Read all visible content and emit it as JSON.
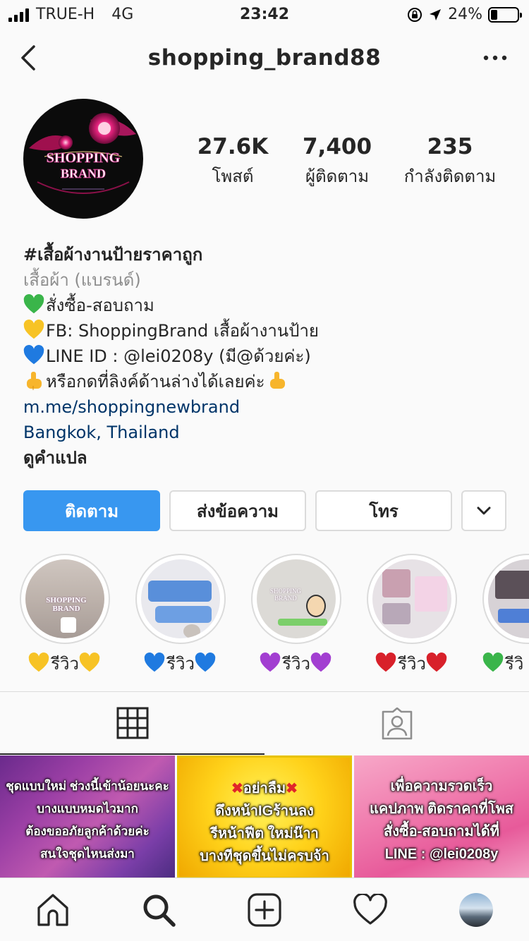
{
  "status_bar": {
    "carrier": "TRUE-H",
    "network": "4G",
    "time": "23:42",
    "battery": "24%",
    "battery_level": 0.24
  },
  "header": {
    "username": "shopping_brand88"
  },
  "profile": {
    "avatar_text_line1": "SHOPPING",
    "avatar_text_line2": "BRAND",
    "stats": [
      {
        "value": "27.6K",
        "label": "โพสต์"
      },
      {
        "value": "7,400",
        "label": "ผู้ติดตาม"
      },
      {
        "value": "235",
        "label": "กำลังติดตาม"
      }
    ]
  },
  "bio": {
    "name": "#เสื้อผ้างานป้ายราคาถูก",
    "category": "เสื้อผ้า (แบรนด์)",
    "line_order": "สั่งซื้อ-สอบถาม",
    "line_fb": "FB: ShoppingBrand เสื้อผ้างานป้าย",
    "line_lineid": "LINE ID : @lei0208y (มี@ด้วยค่ะ)",
    "line_click": "หรือกดที่ลิงค์ด้านล่างได้เลยค่ะ",
    "link": "m.me/shoppingnewbrand",
    "location": "Bangkok, Thailand",
    "translate": "ดูคำแปล"
  },
  "actions": {
    "follow": "ติดตาม",
    "message": "ส่งข้อความ",
    "call": "โทร"
  },
  "highlights": [
    {
      "label": "รีวิว",
      "heart_color": "#f7c325"
    },
    {
      "label": "รีวิว",
      "heart_color": "#1f7ae0"
    },
    {
      "label": "รีวิว",
      "heart_color": "#a23ed1"
    },
    {
      "label": "รีวิว",
      "heart_color": "#d8202a"
    },
    {
      "label": "รีวิ",
      "heart_color": "#3ab54a"
    }
  ],
  "posts": [
    {
      "lines": [
        "ชุดแบบใหม่ ช่วงนี้เข้าน้อยนะคะ",
        "บางแบบหมดไวมาก",
        "ต้องขออภัยลูกค้าด้วยค่ะ",
        "สนใจชุดไหนส่งมา"
      ]
    },
    {
      "lines": [
        "อย่าลืม",
        "ดึงหน้าIGร้านลง",
        "รีหน้าฟีต ใหม่น๊าา",
        "บางทีชุดขึ้นไม่ครบจ้า"
      ]
    },
    {
      "lines": [
        "เพื่อความรวดเร็ว",
        "แคปภาพ ติดราคาที่โพส",
        "สั่งซื้อ-สอบถามได้ที่",
        "LINE : @lei0208y"
      ]
    }
  ],
  "colors": {
    "follow_button": "#3897f0",
    "link": "#003569",
    "muted": "#8e8e8e",
    "border": "#dbdbdb"
  },
  "icons": {
    "back": "chevron-left-icon",
    "more": "ellipsis-icon",
    "dropdown": "chevron-down-icon",
    "grid": "grid-icon",
    "tagged": "tagged-person-icon",
    "home": "home-icon",
    "search": "search-icon",
    "add": "add-post-icon",
    "activity": "heart-icon"
  }
}
